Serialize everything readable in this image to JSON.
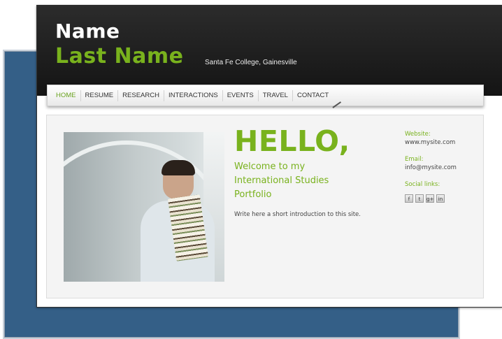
{
  "header": {
    "first_name": "Name",
    "last_name": "Last Name",
    "college": "Santa Fe College, Gainesville"
  },
  "nav": {
    "items": [
      {
        "label": "HOME"
      },
      {
        "label": "RESUME"
      },
      {
        "label": "RESEARCH"
      },
      {
        "label": "INTERACTIONS"
      },
      {
        "label": "EVENTS"
      },
      {
        "label": "TRAVEL"
      },
      {
        "label": "CONTACT"
      }
    ]
  },
  "main": {
    "hello": "HELLO,",
    "welcome": "Welcome to my International Studies Portfolio",
    "intro": "Write here a short introduction to this site."
  },
  "contact": {
    "website_label": "Website:",
    "website_value": "www.mysite.com",
    "email_label": "Email:",
    "email_value": "info@mysite.com",
    "social_label": "Social links:",
    "social_icons": [
      {
        "name": "facebook-icon",
        "glyph": "f"
      },
      {
        "name": "twitter-icon",
        "glyph": "t"
      },
      {
        "name": "google-plus-icon",
        "glyph": "g+"
      },
      {
        "name": "linkedin-icon",
        "glyph": "in"
      }
    ]
  },
  "colors": {
    "accent_green": "#79b21d",
    "header_dark": "#1a1a1a",
    "backdrop_blue": "#345f87"
  }
}
